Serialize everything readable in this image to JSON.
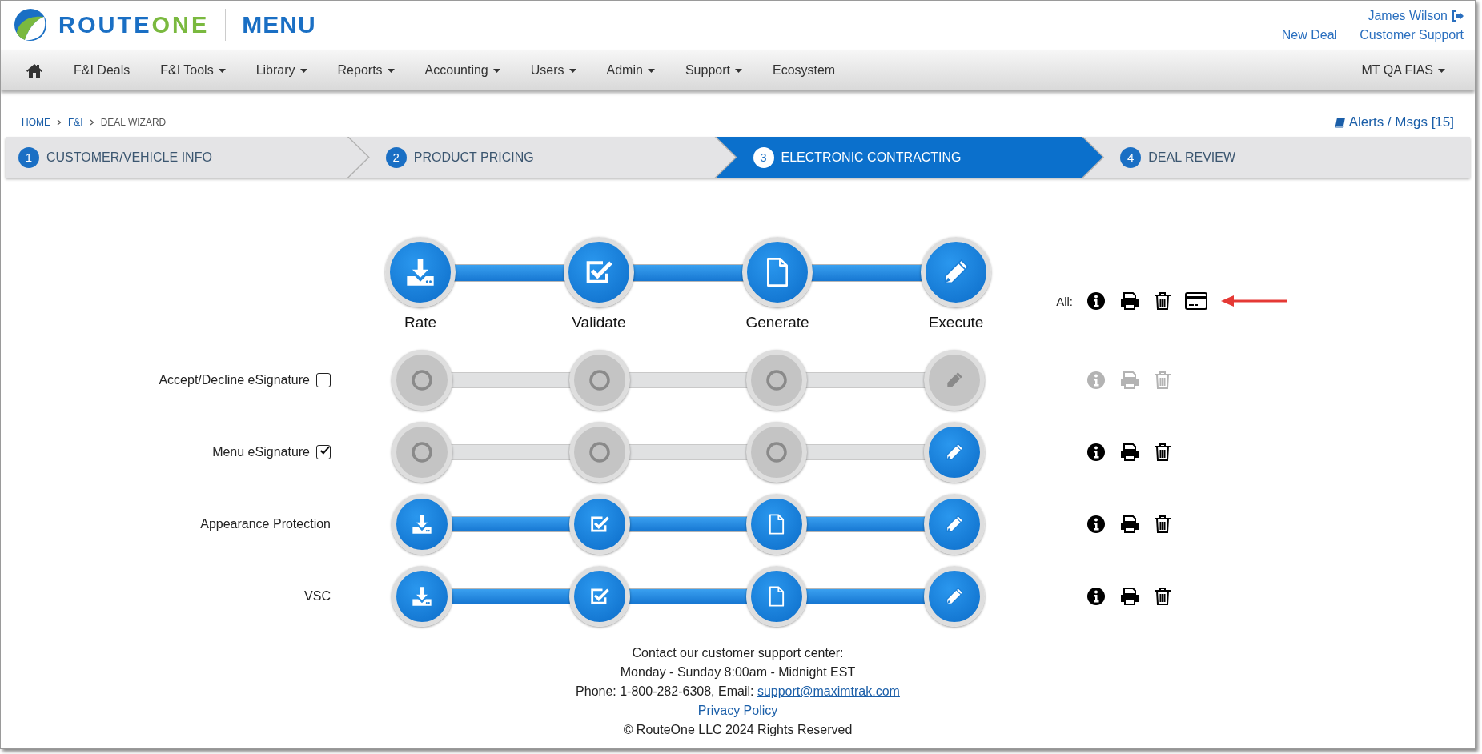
{
  "header": {
    "brand_parts": [
      "ROUTE",
      "ONE"
    ],
    "product": "MENU",
    "user": "James Wilson",
    "links": [
      "New Deal",
      "Customer Support"
    ]
  },
  "nav": {
    "items": [
      {
        "label": "F&I Deals",
        "dropdown": false
      },
      {
        "label": "F&I Tools",
        "dropdown": true
      },
      {
        "label": "Library",
        "dropdown": true
      },
      {
        "label": "Reports",
        "dropdown": true
      },
      {
        "label": "Accounting",
        "dropdown": true
      },
      {
        "label": "Users",
        "dropdown": true
      },
      {
        "label": "Admin",
        "dropdown": true
      },
      {
        "label": "Support",
        "dropdown": true
      },
      {
        "label": "Ecosystem",
        "dropdown": false
      }
    ],
    "account": {
      "label": "MT QA FIAS",
      "dropdown": true
    }
  },
  "breadcrumb": [
    {
      "label": "HOME",
      "link": true
    },
    {
      "label": "F&I",
      "link": true
    },
    {
      "label": "DEAL WIZARD",
      "link": false
    }
  ],
  "alerts": "Alerts / Msgs [15]",
  "wizard_steps": [
    {
      "number": "1",
      "label": "CUSTOMER/VEHICLE INFO",
      "selected": false
    },
    {
      "number": "2",
      "label": "PRODUCT PRICING",
      "selected": false
    },
    {
      "number": "3",
      "label": "ELECTRONIC CONTRACTING",
      "selected": true
    },
    {
      "number": "4",
      "label": "DEAL REVIEW",
      "selected": false
    }
  ],
  "workflow": {
    "stages": [
      {
        "kind": "rate",
        "label": "Rate"
      },
      {
        "kind": "validate",
        "label": "Validate"
      },
      {
        "kind": "generate",
        "label": "Generate"
      },
      {
        "kind": "execute",
        "label": "Execute"
      }
    ],
    "all_label": "All:"
  },
  "products": [
    {
      "name": "Accept/Decline eSignature",
      "kind": "checkbox",
      "checked": false,
      "actions_disabled": true,
      "stages": [
        {
          "active": false
        },
        {
          "active": false
        },
        {
          "active": false
        },
        {
          "active": false
        }
      ]
    },
    {
      "name": "Menu eSignature",
      "kind": "checkbox",
      "checked": true,
      "actions_disabled": false,
      "stages": [
        {
          "active": false
        },
        {
          "active": false
        },
        {
          "active": false
        },
        {
          "active": true
        }
      ]
    },
    {
      "name": "Appearance Protection",
      "kind": "plain",
      "actions_disabled": false,
      "stages": [
        {
          "active": true
        },
        {
          "active": true
        },
        {
          "active": true
        },
        {
          "active": true
        }
      ]
    },
    {
      "name": "VSC",
      "kind": "plain",
      "actions_disabled": false,
      "stages": [
        {
          "active": true
        },
        {
          "active": true
        },
        {
          "active": true
        },
        {
          "active": true
        }
      ]
    }
  ],
  "footer": {
    "lines": [
      "Contact our customer support center:",
      "Monday - Sunday 8:00am - Midnight EST"
    ],
    "phone": "Phone: 1-800-282-6308, Email: ",
    "email": "support@maximtrak.com",
    "privacy": "Privacy Policy",
    "copyright": "© RouteOne LLC 2024 Rights Reserved"
  }
}
